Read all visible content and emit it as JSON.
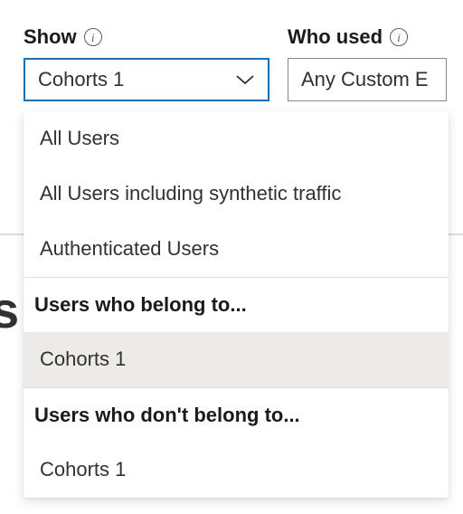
{
  "filters": {
    "show": {
      "label": "Show",
      "selected": "Cohorts 1"
    },
    "whoUsed": {
      "label": "Who used",
      "selected": "Any Custom E"
    }
  },
  "dropdown": {
    "item0": "All Users",
    "item1": "All Users including synthetic traffic",
    "item2": "Authenticated Users",
    "header0": "Users who belong to...",
    "item3": "Cohorts 1",
    "header1": "Users who don't belong to...",
    "item4": "Cohorts 1"
  },
  "bg_letter": "s"
}
